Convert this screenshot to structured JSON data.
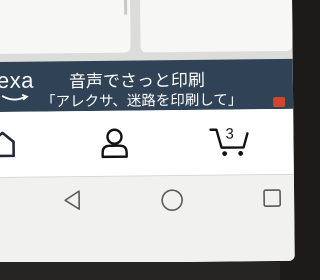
{
  "banner": {
    "logo_text": "exa",
    "title": "音声でさっと印刷",
    "subtitle": "「アレクサ、迷路を印刷して」",
    "color": "#2f4256"
  },
  "app_nav": {
    "items": [
      {
        "icon": "home-icon"
      },
      {
        "icon": "account-icon"
      },
      {
        "icon": "cart-icon",
        "count": "3"
      }
    ]
  },
  "system_nav": {
    "items": [
      {
        "icon": "back-icon"
      },
      {
        "icon": "home-circle-icon"
      },
      {
        "icon": "recent-apps-icon"
      }
    ]
  }
}
